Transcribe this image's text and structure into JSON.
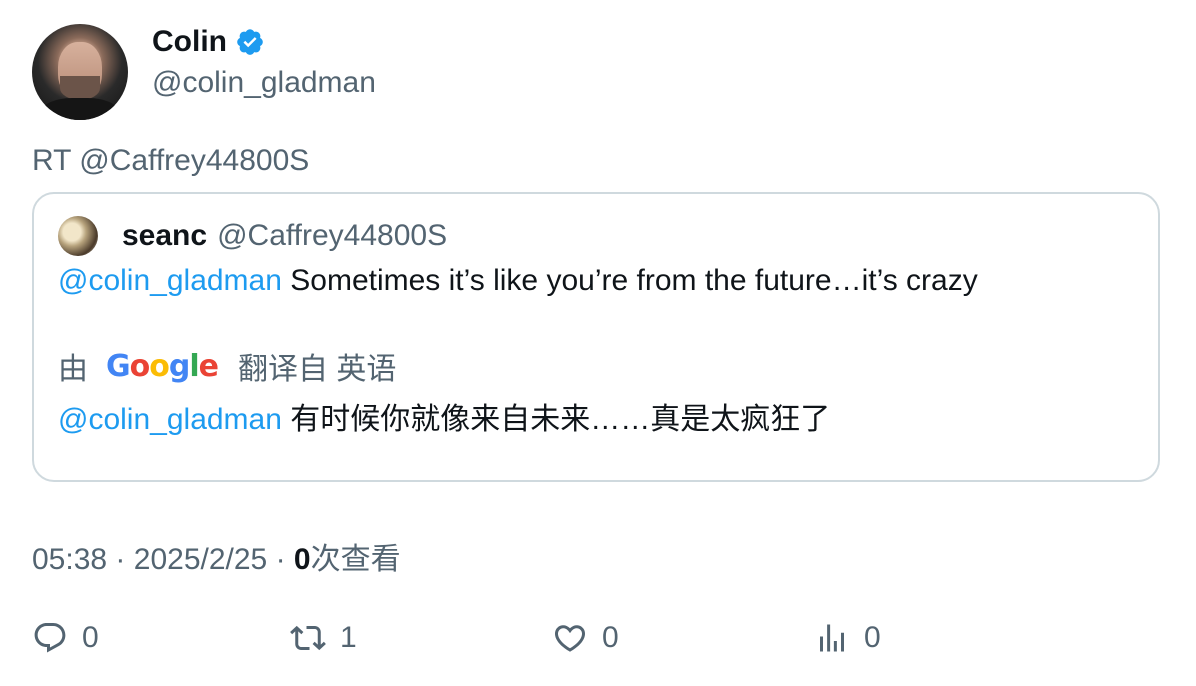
{
  "author": {
    "display_name": "Colin",
    "handle": "@colin_gladman",
    "verified_icon": "verified-badge-icon"
  },
  "retweet_text": "RT @Caffrey44800S",
  "quote": {
    "name": "seanc",
    "handle": "@Caffrey44800S",
    "mention": "@colin_gladman",
    "text": "Sometimes it’s like you’re from the future…it’s crazy",
    "translate_prefix": "由",
    "google_logo": "Google",
    "translate_suffix": "翻译自 英语",
    "translated_mention": "@colin_gladman",
    "translated_text": "有时候你就像来自未来……真是太疯狂了"
  },
  "meta": {
    "time": "05:38",
    "date": "2025/2/25",
    "views_count": "0",
    "views_label": "次查看",
    "separator": "·"
  },
  "actions": {
    "reply_count": "0",
    "retweet_count": "1",
    "like_count": "0",
    "views_count": "0"
  },
  "colors": {
    "accent": "#1d9bf0",
    "secondary_text": "#536471",
    "border": "#cfd9de"
  }
}
